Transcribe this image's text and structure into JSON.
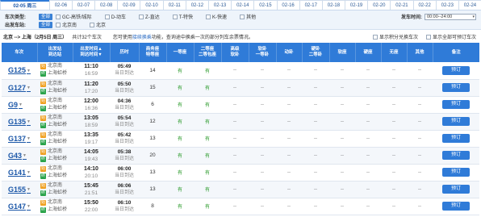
{
  "date_tabs": [
    {
      "label": "02-05 周三",
      "active": true
    },
    {
      "label": "02-06"
    },
    {
      "label": "02-07"
    },
    {
      "label": "02-08"
    },
    {
      "label": "02-09"
    },
    {
      "label": "02-10"
    },
    {
      "label": "02-11"
    },
    {
      "label": "02-12"
    },
    {
      "label": "02-13"
    },
    {
      "label": "02-14"
    },
    {
      "label": "02-15"
    },
    {
      "label": "02-16"
    },
    {
      "label": "02-17"
    },
    {
      "label": "02-18"
    },
    {
      "label": "02-19"
    },
    {
      "label": "02-20"
    },
    {
      "label": "02-21"
    },
    {
      "label": "02-22"
    },
    {
      "label": "02-23"
    },
    {
      "label": "02-24"
    }
  ],
  "filter": {
    "train_type_label": "车次类型:",
    "all_label": "全部",
    "types": [
      "GC-高铁/城际",
      "D-动车",
      "Z-直达",
      "T-特快",
      "K-快速",
      "其他"
    ],
    "station_label": "出发车站:",
    "stations": [
      "北京南",
      "北京"
    ],
    "dep_time_label": "发车时间:",
    "dep_time_value": "00:00--24:00"
  },
  "summary": {
    "route": "北京 --> 上海（2月5日 周三）",
    "count": "共计32个车次",
    "hint_prefix": "您可使用",
    "hint_link": "接续换乘",
    "hint_suffix": "功能，查询途中换乘一次的部分列车余票情况。",
    "opt_points": "显示积分兑换车次",
    "opt_bookable": "显示全部可预订车次"
  },
  "table": {
    "headers": [
      "车次",
      "出发站\n到达站",
      "出发时间▲\n到达时间▼",
      "历时",
      "商务座\n特等座",
      "一等座",
      "二等座\n二等包座",
      "高级\n软卧",
      "软卧\n一等卧",
      "动卧",
      "硬卧\n二等卧",
      "软座",
      "硬座",
      "无座",
      "其他",
      "备注"
    ],
    "book_label": "预订",
    "start_tag": "始",
    "end_tag": "终",
    "rows": [
      {
        "code": "G125",
        "from": "北京南",
        "to": "上海虹桥",
        "dep": "11:10",
        "arr": "16:59",
        "dur": "05:49",
        "day": "当日到达",
        "biz": "14",
        "first": "有",
        "second": "有"
      },
      {
        "code": "G127",
        "from": "北京南",
        "to": "上海虹桥",
        "dep": "11:20",
        "arr": "17:20",
        "dur": "05:50",
        "day": "当日到达",
        "biz": "15",
        "first": "有",
        "second": "有"
      },
      {
        "code": "G9",
        "from": "北京南",
        "to": "上海虹桥",
        "dep": "12:00",
        "arr": "16:36",
        "dur": "04:36",
        "day": "当日到达",
        "biz": "6",
        "first": "有",
        "second": "有"
      },
      {
        "code": "G135",
        "from": "北京南",
        "to": "上海虹桥",
        "dep": "13:05",
        "arr": "18:59",
        "dur": "05:54",
        "day": "当日到达",
        "biz": "12",
        "first": "有",
        "second": "有"
      },
      {
        "code": "G137",
        "from": "北京南",
        "to": "上海虹桥",
        "dep": "13:35",
        "arr": "19:17",
        "dur": "05:42",
        "day": "当日到达",
        "biz": "13",
        "first": "有",
        "second": "有"
      },
      {
        "code": "G43",
        "from": "北京南",
        "to": "上海虹桥",
        "dep": "14:05",
        "arr": "19:43",
        "dur": "05:38",
        "day": "当日到达",
        "biz": "20",
        "first": "有",
        "second": "有"
      },
      {
        "code": "G141",
        "from": "北京南",
        "to": "上海虹桥",
        "dep": "14:10",
        "arr": "20:10",
        "dur": "06:00",
        "day": "当日到达",
        "biz": "13",
        "first": "有",
        "second": "有"
      },
      {
        "code": "G155",
        "from": "北京南",
        "to": "上海虹桥",
        "dep": "15:45",
        "arr": "21:51",
        "dur": "06:06",
        "day": "当日到达",
        "biz": "13",
        "first": "有",
        "second": "有"
      },
      {
        "code": "G147",
        "from": "北京南",
        "to": "上海虹桥",
        "dep": "15:50",
        "arr": "22:00",
        "dur": "06:10",
        "day": "当日到达",
        "biz": "8",
        "first": "有",
        "second": "有"
      }
    ],
    "empty_mark": "--"
  }
}
